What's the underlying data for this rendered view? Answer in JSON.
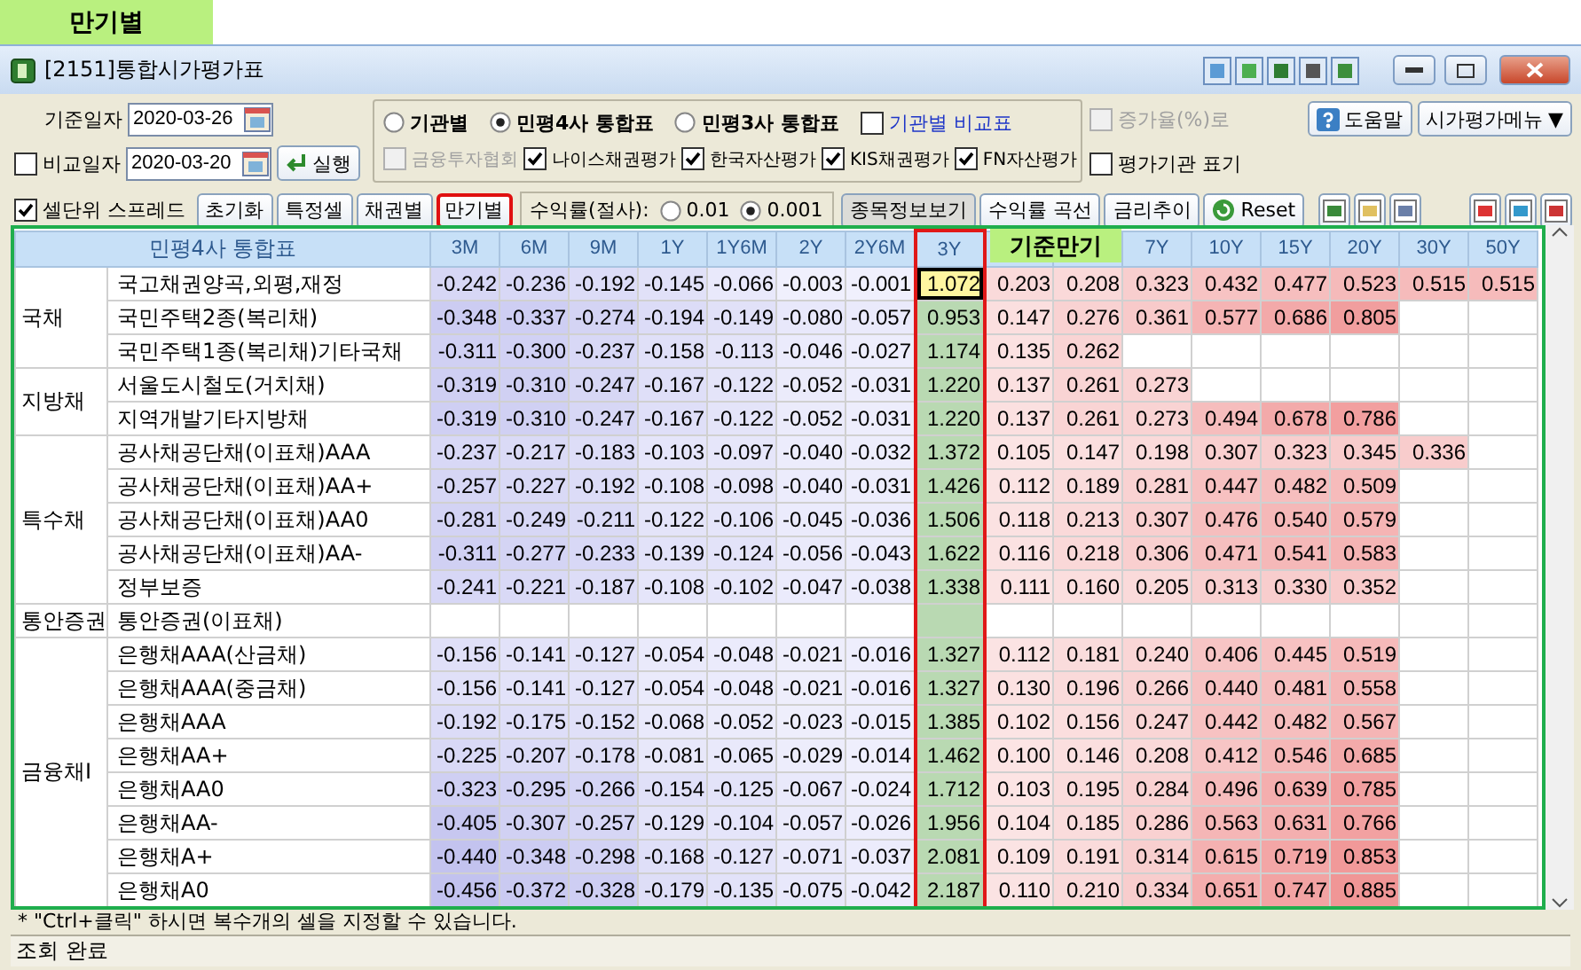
{
  "banner": {
    "label": "만기별"
  },
  "window": {
    "title": "[2151]통합시가평가표"
  },
  "controls": {
    "base_date": {
      "label": "기준일자",
      "value": "2020-03-26"
    },
    "compare_date": {
      "label": "비교일자",
      "checked": false,
      "value": "2020-03-20"
    },
    "run_button": "실행",
    "source_options": [
      {
        "label": "기관별",
        "selected": false
      },
      {
        "label": "민평4사 통합표",
        "selected": true
      },
      {
        "label": "민평3사 통합표",
        "selected": false
      }
    ],
    "compare_table": {
      "label": "기관별 비교표",
      "checked": false
    },
    "agencies": [
      {
        "label": "금융투자협회",
        "checked": false,
        "disabled": true
      },
      {
        "label": "나이스채권평가",
        "checked": true,
        "disabled": false
      },
      {
        "label": "한국자산평가",
        "checked": true,
        "disabled": false
      },
      {
        "label": "KIS채권평가",
        "checked": true,
        "disabled": false
      },
      {
        "label": "FN자산평가",
        "checked": true,
        "disabled": false
      }
    ],
    "growth_rate": {
      "label": "증가율(%)로",
      "checked": false,
      "disabled": true
    },
    "show_agency": {
      "label": "평가기관 표기",
      "checked": false,
      "disabled": false
    },
    "help_button": "도움말",
    "menu_button": {
      "label": "시가평가메뉴",
      "caret": "▼"
    },
    "cell_spread": {
      "label": "셀단위 스프레드",
      "checked": true
    },
    "mode_buttons": [
      {
        "label": "초기화",
        "selected": false
      },
      {
        "label": "특정셀",
        "selected": false
      },
      {
        "label": "채권별",
        "selected": false
      },
      {
        "label": "만기별",
        "selected": true
      }
    ],
    "rounding": {
      "label": "수익률(절사):",
      "options": [
        {
          "label": "0.01",
          "selected": false
        },
        {
          "label": "0.001",
          "selected": true
        }
      ]
    },
    "action_buttons": [
      "종목정보보기",
      "수익률 곡선",
      "금리추이"
    ],
    "reset_button": "Reset"
  },
  "grid": {
    "corner": "민평4사 통합표",
    "overlay_label": "기준만기",
    "columns": [
      {
        "kind": "label",
        "label": "3M",
        "highlighted": false
      },
      {
        "kind": "label",
        "label": "6M",
        "highlighted": false
      },
      {
        "kind": "label",
        "label": "9M",
        "highlighted": false
      },
      {
        "kind": "label",
        "label": "1Y",
        "highlighted": false
      },
      {
        "kind": "label",
        "label": "1Y6M",
        "highlighted": false
      },
      {
        "kind": "label",
        "label": "2Y",
        "highlighted": false
      },
      {
        "kind": "label",
        "label": "2Y6M",
        "highlighted": false
      },
      {
        "kind": "label",
        "label": "3Y",
        "highlighted": true
      },
      {
        "kind": "covered",
        "highlighted": false
      },
      {
        "kind": "covered",
        "highlighted": false
      },
      {
        "kind": "label",
        "label": "7Y",
        "highlighted": false
      },
      {
        "kind": "label",
        "label": "10Y",
        "highlighted": false
      },
      {
        "kind": "label",
        "label": "15Y",
        "highlighted": false
      },
      {
        "kind": "label",
        "label": "20Y",
        "highlighted": false
      },
      {
        "kind": "label",
        "label": "30Y",
        "highlighted": false
      },
      {
        "kind": "label",
        "label": "50Y",
        "highlighted": false
      }
    ],
    "groups": [
      {
        "name": "국채",
        "rows": [
          {
            "name": "국고채권양곡,외평,재정",
            "cells": [
              "-0.242",
              "-0.236",
              "-0.192",
              "-0.145",
              "-0.066",
              "-0.003",
              "-0.001",
              {
                "text": "1.072",
                "selected": true
              },
              "0.203",
              "0.208",
              "0.323",
              "0.432",
              "0.477",
              "0.523",
              "0.515",
              "0.515"
            ]
          },
          {
            "name": "국민주택2종(복리채)",
            "cells": [
              "-0.348",
              "-0.337",
              "-0.274",
              "-0.194",
              "-0.149",
              "-0.080",
              "-0.057",
              "0.953",
              "0.147",
              "0.276",
              "0.361",
              "0.577",
              "0.686",
              "0.805"
            ]
          },
          {
            "name": "국민주택1종(복리채)기타국채",
            "cells": [
              "-0.311",
              "-0.300",
              "-0.237",
              "-0.158",
              "-0.113",
              "-0.046",
              "-0.027",
              "1.174",
              "0.135",
              "0.262"
            ]
          }
        ]
      },
      {
        "name": "지방채",
        "rows": [
          {
            "name": "서울도시철도(거치채)",
            "cells": [
              "-0.319",
              "-0.310",
              "-0.247",
              "-0.167",
              "-0.122",
              "-0.052",
              "-0.031",
              "1.220",
              "0.137",
              "0.261",
              "0.273"
            ]
          },
          {
            "name": "지역개발기타지방채",
            "cells": [
              "-0.319",
              "-0.310",
              "-0.247",
              "-0.167",
              "-0.122",
              "-0.052",
              "-0.031",
              "1.220",
              "0.137",
              "0.261",
              "0.273",
              "0.494",
              "0.678",
              "0.786"
            ]
          }
        ]
      },
      {
        "name": "특수채",
        "rows": [
          {
            "name": "공사채공단채(이표채)AAA",
            "cells": [
              "-0.237",
              "-0.217",
              "-0.183",
              "-0.103",
              "-0.097",
              "-0.040",
              "-0.032",
              "1.372",
              "0.105",
              "0.147",
              "0.198",
              "0.307",
              "0.323",
              "0.345",
              "0.336"
            ]
          },
          {
            "name": "공사채공단채(이표채)AA+",
            "cells": [
              "-0.257",
              "-0.227",
              "-0.192",
              "-0.108",
              "-0.098",
              "-0.040",
              "-0.031",
              "1.426",
              "0.112",
              "0.189",
              "0.281",
              "0.447",
              "0.482",
              "0.509"
            ]
          },
          {
            "name": "공사채공단채(이표채)AA0",
            "cells": [
              "-0.281",
              "-0.249",
              "-0.211",
              "-0.122",
              "-0.106",
              "-0.045",
              "-0.036",
              "1.506",
              "0.118",
              "0.213",
              "0.307",
              "0.476",
              "0.540",
              "0.579"
            ]
          },
          {
            "name": "공사채공단채(이표채)AA-",
            "cells": [
              "-0.311",
              "-0.277",
              "-0.233",
              "-0.139",
              "-0.124",
              "-0.056",
              "-0.043",
              "1.622",
              "0.116",
              "0.218",
              "0.306",
              "0.471",
              "0.541",
              "0.583"
            ]
          },
          {
            "name": "정부보증",
            "cells": [
              "-0.241",
              "-0.221",
              "-0.187",
              "-0.108",
              "-0.102",
              "-0.047",
              "-0.038",
              "1.338",
              "0.111",
              "0.160",
              "0.205",
              "0.313",
              "0.330",
              "0.352"
            ]
          }
        ]
      },
      {
        "name": "통안증권",
        "rows": [
          {
            "name": "통안증권(이표채)"
          }
        ]
      },
      {
        "name": "금융채Ⅰ",
        "rows": [
          {
            "name": "은행채AAA(산금채)",
            "cells": [
              "-0.156",
              "-0.141",
              "-0.127",
              "-0.054",
              "-0.048",
              "-0.021",
              "-0.016",
              "1.327",
              "0.112",
              "0.181",
              "0.240",
              "0.406",
              "0.445",
              "0.519"
            ]
          },
          {
            "name": "은행채AAA(중금채)",
            "cells": [
              "-0.156",
              "-0.141",
              "-0.127",
              "-0.054",
              "-0.048",
              "-0.021",
              "-0.016",
              "1.327",
              "0.130",
              "0.196",
              "0.266",
              "0.440",
              "0.481",
              "0.558"
            ]
          },
          {
            "name": "은행채AAA",
            "cells": [
              "-0.192",
              "-0.175",
              "-0.152",
              "-0.068",
              "-0.052",
              "-0.023",
              "-0.015",
              "1.385",
              "0.102",
              "0.156",
              "0.247",
              "0.442",
              "0.482",
              "0.567"
            ]
          },
          {
            "name": "은행채AA+",
            "cells": [
              "-0.225",
              "-0.207",
              "-0.178",
              "-0.081",
              "-0.065",
              "-0.029",
              "-0.014",
              "1.462",
              "0.100",
              "0.146",
              "0.208",
              "0.412",
              "0.546",
              "0.685"
            ]
          },
          {
            "name": "은행채AA0",
            "cells": [
              "-0.323",
              "-0.295",
              "-0.266",
              "-0.154",
              "-0.125",
              "-0.067",
              "-0.024",
              "1.712",
              "0.103",
              "0.195",
              "0.284",
              "0.496",
              "0.639",
              "0.785"
            ]
          },
          {
            "name": "은행채AA-",
            "cells": [
              "-0.405",
              "-0.307",
              "-0.257",
              "-0.129",
              "-0.104",
              "-0.057",
              "-0.026",
              "1.956",
              "0.104",
              "0.185",
              "0.286",
              "0.563",
              "0.631",
              "0.766"
            ]
          },
          {
            "name": "은행채A+",
            "cells": [
              "-0.440",
              "-0.348",
              "-0.298",
              "-0.168",
              "-0.127",
              "-0.071",
              "-0.037",
              "2.081",
              "0.109",
              "0.191",
              "0.314",
              "0.615",
              "0.719",
              "0.853"
            ]
          },
          {
            "name": "은행채A0",
            "cells": [
              "-0.456",
              "-0.372",
              "-0.328",
              "-0.179",
              "-0.135",
              "-0.075",
              "-0.042",
              "2.187",
              "0.110",
              "0.210",
              "0.334",
              "0.651",
              "0.747",
              "0.885"
            ]
          }
        ]
      }
    ]
  },
  "footer": {
    "note": "* \"Ctrl+클릭\" 하시면 복수개의 셀을 지정할 수 있습니다.",
    "status": "조회 완료"
  }
}
